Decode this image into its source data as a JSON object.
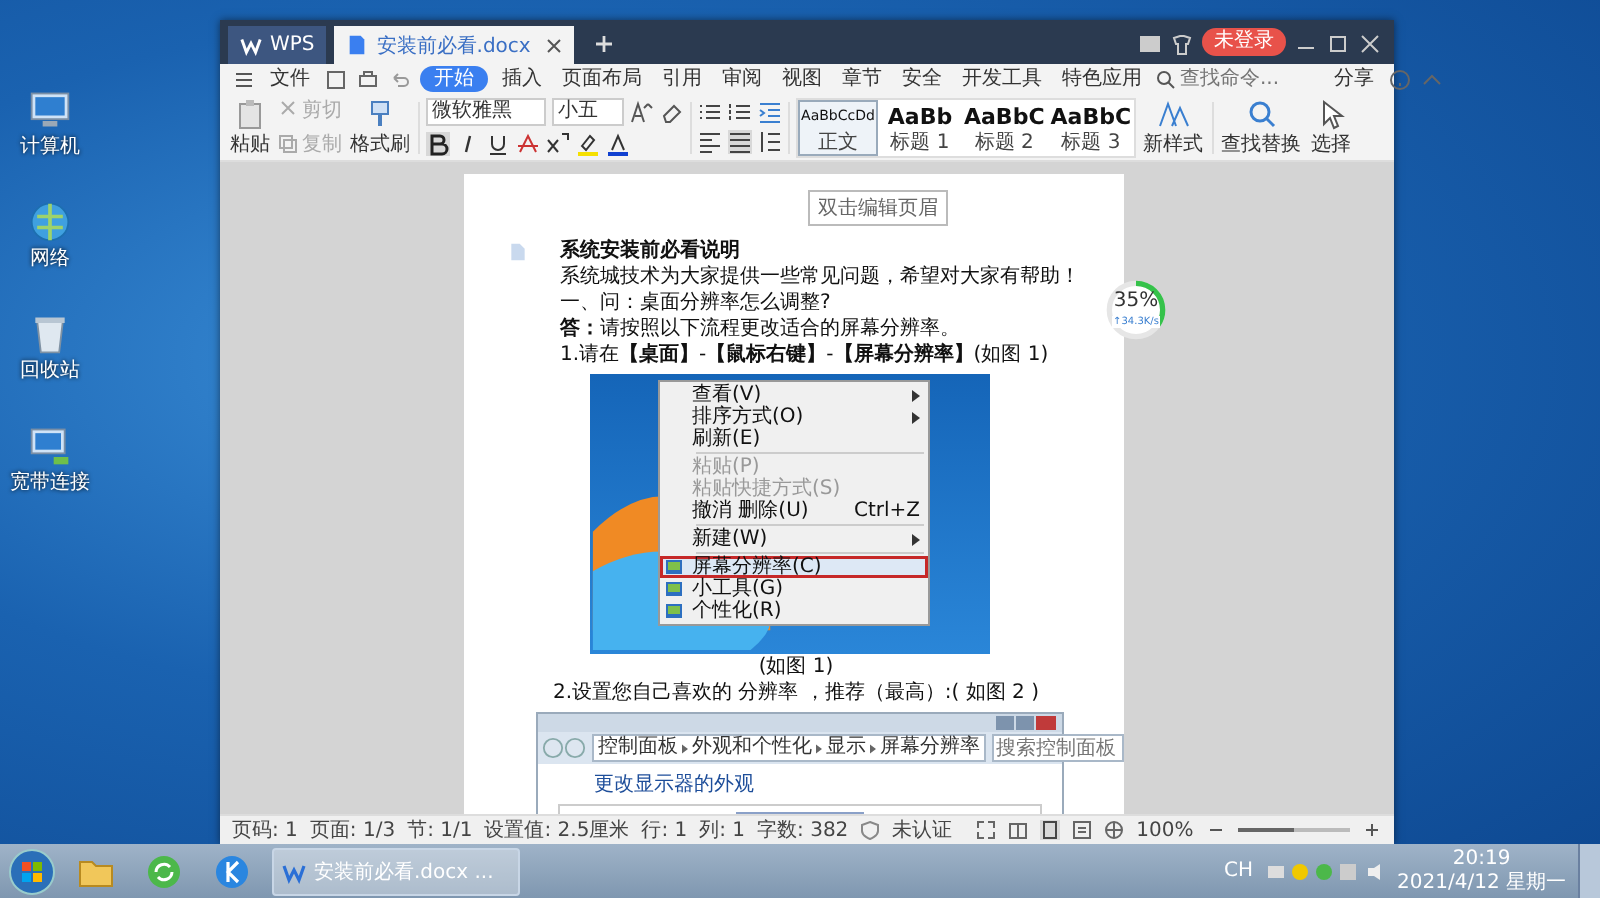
{
  "desktop_icons": [
    {
      "label": "计算机",
      "kind": "computer"
    },
    {
      "label": "网络",
      "kind": "network"
    },
    {
      "label": "回收站",
      "kind": "bin"
    },
    {
      "label": "宽带连接",
      "kind": "broadband"
    }
  ],
  "window": {
    "tabs": [
      {
        "label": "WPS",
        "kind": "home",
        "selected": false
      },
      {
        "label": "安装前必看.docx",
        "kind": "doc",
        "selected": true
      }
    ],
    "account": "未登录"
  },
  "menu": {
    "items": [
      {
        "label": "文件",
        "selected": false
      },
      {
        "label": "开始",
        "selected": true
      },
      {
        "label": "插入",
        "selected": false
      },
      {
        "label": "页面布局",
        "selected": false
      },
      {
        "label": "引用",
        "selected": false
      },
      {
        "label": "审阅",
        "selected": false
      },
      {
        "label": "视图",
        "selected": false
      },
      {
        "label": "章节",
        "selected": false
      },
      {
        "label": "安全",
        "selected": false
      },
      {
        "label": "开发工具",
        "selected": false
      },
      {
        "label": "特色应用",
        "selected": false
      }
    ],
    "search": {
      "placeholder": "查找命令..."
    },
    "share": "分享"
  },
  "ribbon": {
    "paste": "粘贴",
    "cut": "剪切",
    "copy": "复制",
    "format_painter": "格式刷",
    "font": "微软雅黑",
    "size": "小五",
    "styles": [
      {
        "sample": "AaBbCcDd",
        "label": "正文",
        "selected": true
      },
      {
        "sample": "AaBb",
        "label": "标题 1",
        "selected": false
      },
      {
        "sample": "AaBbC",
        "label": "标题 2",
        "selected": false
      },
      {
        "sample": "AaBbC",
        "label": "标题 3",
        "selected": false
      }
    ],
    "new_style": "新样式",
    "find_replace": "查找替换",
    "select": "选择"
  },
  "document": {
    "header_hint": "双击编辑页眉",
    "title": "系统安装前必看说明",
    "paragraphs": [
      "系统城技术为大家提供一些常见问题，希望对大家有帮助！",
      "一、问：桌面分辨率怎么调整?",
      "**答：**请按照以下流程更改适合的屏幕分辨率。",
      "1.请在**【桌面】**-**【鼠标右键】**-**【屏幕分辨率】**(如图 1)"
    ],
    "figure_1": {
      "menu_groups": [
        [
          {
            "label": "查看(V)",
            "kind": "submenu",
            "selected": false
          },
          {
            "label": "排序方式(O)",
            "kind": "submenu",
            "selected": false
          },
          {
            "label": "刷新(E)",
            "kind": "plain",
            "selected": false
          }
        ],
        [
          {
            "label": "粘贴(P)",
            "kind": "disabled",
            "selected": false
          },
          {
            "label": "粘贴快捷方式(S)",
            "kind": "disabled",
            "selected": false
          },
          {
            "label": "撤消 删除(U)",
            "kind": "plain",
            "selected": false,
            "shortcut": "Ctrl+Z"
          }
        ],
        [
          {
            "label": "新建(W)",
            "kind": "submenu",
            "selected": false
          }
        ],
        [
          {
            "label": "屏幕分辨率(C)",
            "kind": "app",
            "selected": true
          },
          {
            "label": "小工具(G)",
            "kind": "app",
            "selected": false
          },
          {
            "label": "个性化(R)",
            "kind": "app",
            "selected": false
          }
        ]
      ],
      "caption": "(如图 1)"
    },
    "step_2": "2.设置您自己喜欢的 分辨率 ，推荐（最高）:( 如图 2 )",
    "figure_2": {
      "path": [
        "控制面板",
        "外观和个性化",
        "显示",
        "屏幕分辨率"
      ],
      "search_placeholder": "搜索控制面板",
      "heading": "更改显示器的外观"
    }
  },
  "net_meter": {
    "level": 0.35,
    "percent": "35%",
    "speed": "↑34.3K/s"
  },
  "status_bar": {
    "items": [
      "页码: 1",
      "页面: 1/3",
      "节: 1/1",
      "设置值: 2.5厘米",
      "行: 1",
      "列: 1",
      "字数: 382"
    ],
    "auth": "未认证",
    "zoom": {
      "label": "100%",
      "level": 0.5
    }
  },
  "taskbar": {
    "task": "安装前必看.docx ...",
    "lang": "CH",
    "time": "20:19",
    "date": "2021/4/12 星期一"
  }
}
